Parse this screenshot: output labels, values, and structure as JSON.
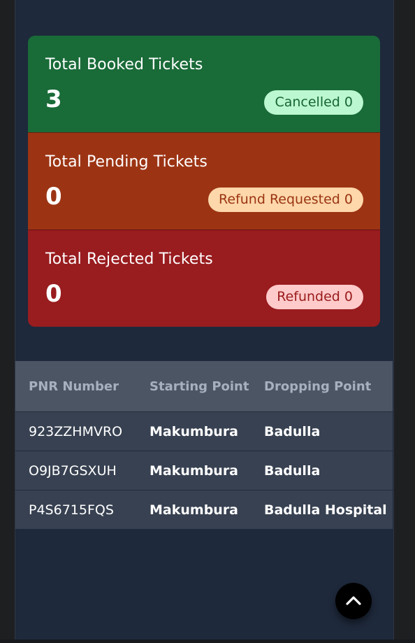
{
  "stats": [
    {
      "label": "Total Booked Tickets",
      "value": "3",
      "badge": "Cancelled 0"
    },
    {
      "label": "Total Pending Tickets",
      "value": "0",
      "badge": "Refund Requested 0"
    },
    {
      "label": "Total Rejected Tickets",
      "value": "0",
      "badge": "Refunded 0"
    }
  ],
  "table": {
    "headers": [
      "PNR Number",
      "Starting Point",
      "Dropping Point"
    ],
    "rows": [
      [
        "923ZZHMVRO",
        "Makumbura",
        "Badulla"
      ],
      [
        "O9JB7GSXUH",
        "Makumbura",
        "Badulla"
      ],
      [
        "P4S6715FQS",
        "Makumbura",
        "Badulla Hospital"
      ]
    ]
  },
  "icons": {
    "scroll_top": "chevron-up-icon"
  },
  "colors": {
    "booked": "#196b38",
    "pending": "#9c3414",
    "rejected": "#991c1f",
    "page": "#1e293b"
  }
}
